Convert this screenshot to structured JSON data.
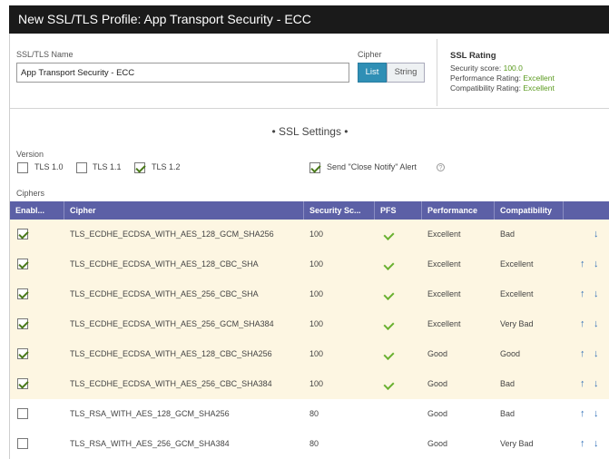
{
  "window": {
    "title": "New SSL/TLS Profile: App Transport Security - ECC"
  },
  "form": {
    "name_label": "SSL/TLS Name",
    "name_value": "App Transport Security - ECC",
    "cipher_label": "Cipher",
    "cipher_mode": {
      "list_label": "List",
      "string_label": "String",
      "selected": "List"
    }
  },
  "rating": {
    "title": "SSL Rating",
    "security_label": "Security score:",
    "security_value": "100.0",
    "performance_label": "Performance Rating:",
    "performance_value": "Excellent",
    "compatibility_label": "Compatibility Rating:",
    "compatibility_value": "Excellent"
  },
  "settings": {
    "title": "• SSL Settings •",
    "version_label": "Version",
    "versions": [
      {
        "label": "TLS 1.0",
        "checked": false
      },
      {
        "label": "TLS 1.1",
        "checked": false
      },
      {
        "label": "TLS 1.2",
        "checked": true
      }
    ],
    "close_notify": {
      "label": "Send \"Close Notify\" Alert",
      "checked": true
    }
  },
  "ciphers": {
    "label": "Ciphers",
    "columns": [
      "Enabl...",
      "Cipher",
      "Security Sc...",
      "PFS",
      "Performance",
      "Compatibility"
    ],
    "rows": [
      {
        "enabled": true,
        "cipher": "TLS_ECDHE_ECDSA_WITH_AES_128_GCM_SHA256",
        "security": "100",
        "pfs": true,
        "performance": "Excellent",
        "compatibility": "Bad",
        "up": false,
        "down": true
      },
      {
        "enabled": true,
        "cipher": "TLS_ECDHE_ECDSA_WITH_AES_128_CBC_SHA",
        "security": "100",
        "pfs": true,
        "performance": "Excellent",
        "compatibility": "Excellent",
        "up": true,
        "down": true
      },
      {
        "enabled": true,
        "cipher": "TLS_ECDHE_ECDSA_WITH_AES_256_CBC_SHA",
        "security": "100",
        "pfs": true,
        "performance": "Excellent",
        "compatibility": "Excellent",
        "up": true,
        "down": true
      },
      {
        "enabled": true,
        "cipher": "TLS_ECDHE_ECDSA_WITH_AES_256_GCM_SHA384",
        "security": "100",
        "pfs": true,
        "performance": "Excellent",
        "compatibility": "Very Bad",
        "up": true,
        "down": true
      },
      {
        "enabled": true,
        "cipher": "TLS_ECDHE_ECDSA_WITH_AES_128_CBC_SHA256",
        "security": "100",
        "pfs": true,
        "performance": "Good",
        "compatibility": "Good",
        "up": true,
        "down": true
      },
      {
        "enabled": true,
        "cipher": "TLS_ECDHE_ECDSA_WITH_AES_256_CBC_SHA384",
        "security": "100",
        "pfs": true,
        "performance": "Good",
        "compatibility": "Bad",
        "up": true,
        "down": true
      },
      {
        "enabled": false,
        "cipher": "TLS_RSA_WITH_AES_128_GCM_SHA256",
        "security": "80",
        "pfs": false,
        "performance": "Good",
        "compatibility": "Bad",
        "up": true,
        "down": true
      },
      {
        "enabled": false,
        "cipher": "TLS_RSA_WITH_AES_256_GCM_SHA384",
        "security": "80",
        "pfs": false,
        "performance": "Good",
        "compatibility": "Very Bad",
        "up": true,
        "down": true
      }
    ]
  },
  "icons": {
    "checkbox": "checkbox-icon",
    "pfs": "check-icon",
    "up": "arrow-up-icon",
    "down": "arrow-down-icon",
    "help": "help-icon"
  },
  "colors": {
    "header_bg": "#5c60a6",
    "enabled_row_bg": "#fdf6e2",
    "accent": "#2f8fb5",
    "rating_good": "#5a9a1e"
  }
}
